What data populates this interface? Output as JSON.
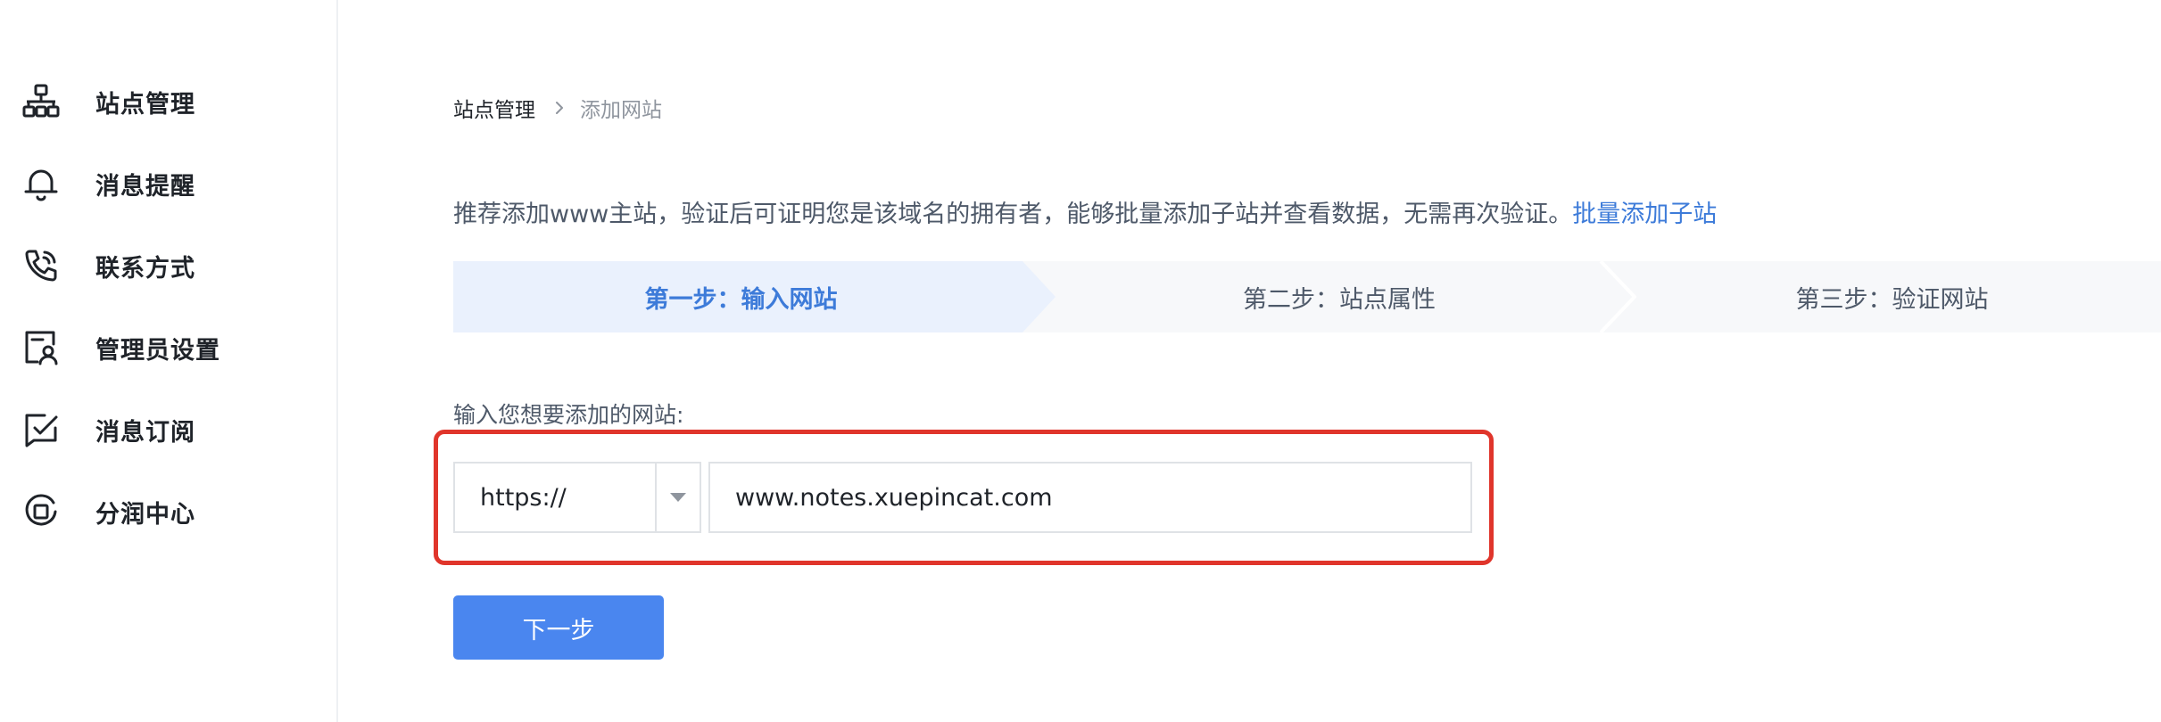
{
  "sidebar": {
    "items": [
      {
        "label": "站点管理",
        "icon": "sitemap-icon"
      },
      {
        "label": "消息提醒",
        "icon": "bell-icon"
      },
      {
        "label": "联系方式",
        "icon": "phone-icon"
      },
      {
        "label": "管理员设置",
        "icon": "admin-user-icon"
      },
      {
        "label": "消息订阅",
        "icon": "message-check-icon"
      },
      {
        "label": "分润中心",
        "icon": "revenue-share-icon"
      }
    ]
  },
  "breadcrumb": {
    "root": "站点管理",
    "current": "添加网站",
    "separator_icon": "chevron-right-icon"
  },
  "intro": {
    "text": "推荐添加www主站，验证后可证明您是该域名的拥有者，能够批量添加子站并查看数据，无需再次验证。",
    "link": "批量添加子站"
  },
  "steps": [
    {
      "label": "第一步：输入网站",
      "active": true
    },
    {
      "label": "第二步：站点属性",
      "active": false
    },
    {
      "label": "第三步：验证网站",
      "active": false
    }
  ],
  "form": {
    "label": "输入您想要添加的网站:",
    "protocol": "https://",
    "protocol_arrow_icon": "caret-down-icon",
    "url": "www.notes.xuepincat.com"
  },
  "buttons": {
    "next": "下一步"
  },
  "colors": {
    "accent": "#4a86ef",
    "link": "#3d7bd9",
    "highlight_border": "#e0352b",
    "active_step_bg": "#eaf1fd"
  }
}
